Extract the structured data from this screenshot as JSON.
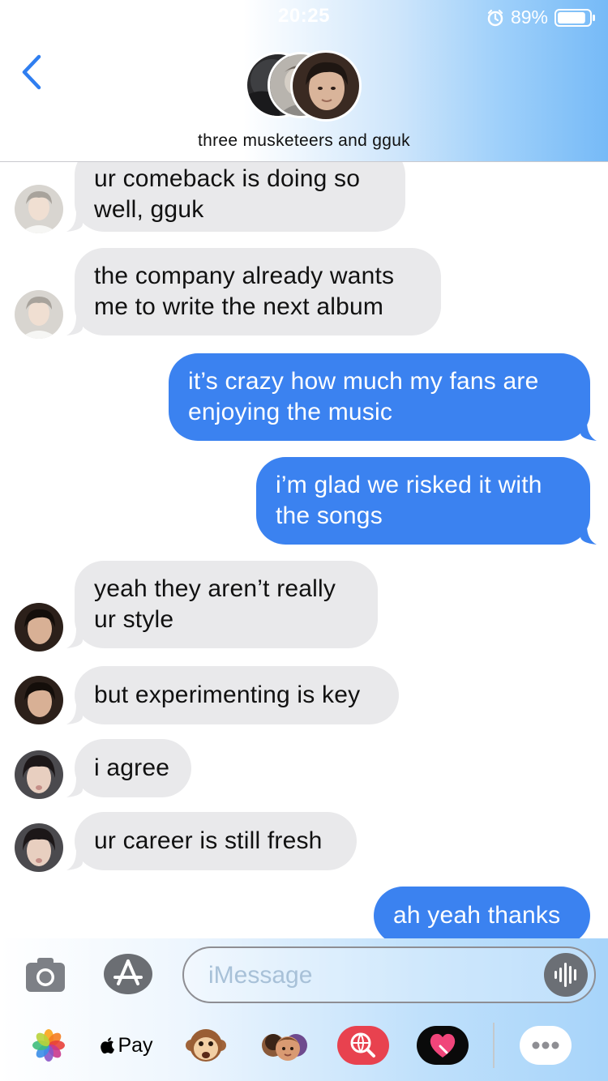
{
  "status_bar": {
    "time": "20:25",
    "battery_percent": "89%",
    "battery_level": 0.89,
    "icons": [
      "alarm-icon",
      "battery-icon"
    ]
  },
  "header": {
    "back_icon": "chevron-left-icon",
    "group_title": "three musketeers and gguk",
    "avatar_count": 3
  },
  "messages": [
    {
      "direction": "incoming",
      "lines": [
        "ur comeback is doing so",
        "well, gguk"
      ]
    },
    {
      "direction": "incoming",
      "lines": [
        "the company already wants",
        "me to write the next album"
      ]
    },
    {
      "direction": "outgoing",
      "lines": [
        "it’s crazy how much my fans are",
        "enjoying the music"
      ]
    },
    {
      "direction": "outgoing",
      "lines": [
        "i’m glad we risked it with",
        "the songs"
      ]
    },
    {
      "direction": "incoming",
      "lines": [
        "yeah they aren’t really",
        "ur style"
      ]
    },
    {
      "direction": "incoming",
      "lines": [
        "but experimenting is key"
      ]
    },
    {
      "direction": "incoming",
      "lines": [
        "i agree"
      ]
    },
    {
      "direction": "incoming",
      "lines": [
        "ur career is still fresh"
      ]
    },
    {
      "direction": "outgoing",
      "lines": [
        "ah yeah thanks"
      ]
    }
  ],
  "input": {
    "placeholder": "iMessage",
    "camera_icon": "camera-icon",
    "apps_icon": "app-store-icon",
    "audio_icon": "audio-waveform-icon"
  },
  "app_drawer": {
    "items": [
      {
        "name": "photos-app-icon"
      },
      {
        "name": "apple-pay-icon",
        "label": "Pay"
      },
      {
        "name": "animoji-monkey-icon"
      },
      {
        "name": "memoji-stickers-icon"
      },
      {
        "name": "web-search-icon"
      },
      {
        "name": "digital-touch-icon"
      },
      {
        "name": "more-apps-icon"
      }
    ]
  },
  "colors": {
    "outgoing_bubble": "#3b82f0",
    "incoming_bubble": "#e9e9eb",
    "back_chevron": "#2f7ef0"
  }
}
